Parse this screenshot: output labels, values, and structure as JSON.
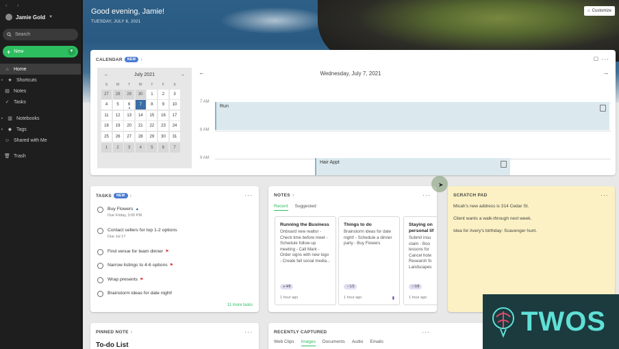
{
  "sidebar": {
    "account": "Jamie Gold",
    "search_placeholder": "Search",
    "new_label": "New",
    "items": [
      {
        "label": "Home",
        "icon": "home-icon"
      },
      {
        "label": "Shortcuts",
        "icon": "star-icon"
      },
      {
        "label": "Notes",
        "icon": "note-icon"
      },
      {
        "label": "Tasks",
        "icon": "check-icon"
      },
      {
        "label": "Notebooks",
        "icon": "notebook-icon"
      },
      {
        "label": "Tags",
        "icon": "tag-icon"
      },
      {
        "label": "Shared with Me",
        "icon": "people-icon"
      },
      {
        "label": "Trash",
        "icon": "trash-icon"
      }
    ]
  },
  "header": {
    "greeting": "Good evening, Jamie!",
    "date": "TUESDAY, JULY 6, 2021",
    "customize_label": "Customize"
  },
  "calendar": {
    "title": "CALENDAR",
    "badge": "NEW",
    "month": "July 2021",
    "dow": [
      "S",
      "M",
      "T",
      "W",
      "T",
      "F",
      "S"
    ],
    "days": [
      "27",
      "28",
      "29",
      "30",
      "1",
      "2",
      "3",
      "4",
      "5",
      "6",
      "7",
      "8",
      "9",
      "10",
      "11",
      "12",
      "13",
      "14",
      "15",
      "16",
      "17",
      "18",
      "19",
      "20",
      "21",
      "22",
      "23",
      "24",
      "25",
      "26",
      "27",
      "28",
      "29",
      "30",
      "31",
      "1",
      "2",
      "3",
      "4",
      "5",
      "6",
      "7"
    ],
    "selected_day": "7",
    "day_title": "Wednesday, July 7, 2021",
    "times": [
      "7 AM",
      "8 AM",
      "9 AM"
    ],
    "events": [
      {
        "label": "Run"
      },
      {
        "label": "Hair Appt"
      }
    ]
  },
  "tasks": {
    "title": "TASKS",
    "badge": "NEW",
    "items": [
      {
        "text": "Buy Flowers",
        "sub": "Due Friday, 3:00 PM"
      },
      {
        "text": "Contact sellers for top 1-2 options",
        "sub": "Due Jul 17"
      },
      {
        "text": "Find venue for team dinner",
        "sub": ""
      },
      {
        "text": "Narrow listings to 4-6 options",
        "sub": ""
      },
      {
        "text": "Wrap presents",
        "sub": ""
      },
      {
        "text": "Brainstorm ideas for date night!",
        "sub": ""
      }
    ],
    "more": "11 more tasks"
  },
  "notes": {
    "title": "NOTES",
    "tabs": [
      "Recent",
      "Suggested"
    ],
    "cards": [
      {
        "title": "Running the Business",
        "body": "Onboard new realtor - Check time before meet - Schedule follow-up meeting - Call Mark - Order signs with new logo - Create fall social media...",
        "tag": "4/8",
        "time": "1 hour ago"
      },
      {
        "title": "Things to do",
        "body": "Brainstorm ideas for date night! - Schedule a dinner party - Buy Flowers",
        "tag": "1/3",
        "time": "1 hour ago"
      },
      {
        "title": "Staying on personal lif",
        "body": "Submit insu claim - Boo lessons for Cancel hote Research fo Landscapes",
        "tag": "0/8",
        "time": "1 hour ago"
      }
    ]
  },
  "scratch": {
    "title": "SCRATCH PAD",
    "lines": [
      "Micah's new address is 314 Cedar St.",
      "Client wants a walk-through next week.",
      "Idea for Avery's birthday: Scavenger hunt."
    ]
  },
  "pinned": {
    "title": "PINNED NOTE",
    "note_title": "To-do List"
  },
  "recent": {
    "title": "RECENTLY CAPTURED",
    "tabs": [
      "Web Clips",
      "Images",
      "Documents",
      "Audio",
      "Emails"
    ]
  },
  "watermark": "TWOS",
  "colors": {
    "accent": "#2dbe60",
    "selected": "#3b6ea5",
    "scratch": "#fbf1c4"
  }
}
